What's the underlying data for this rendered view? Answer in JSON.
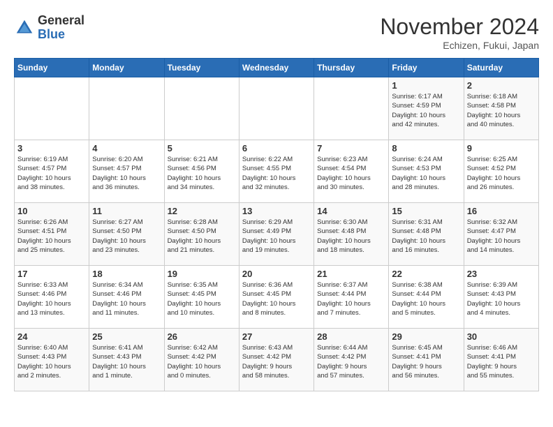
{
  "logo": {
    "general": "General",
    "blue": "Blue"
  },
  "title": "November 2024",
  "subtitle": "Echizen, Fukui, Japan",
  "days_header": [
    "Sunday",
    "Monday",
    "Tuesday",
    "Wednesday",
    "Thursday",
    "Friday",
    "Saturday"
  ],
  "weeks": [
    [
      {
        "day": "",
        "info": ""
      },
      {
        "day": "",
        "info": ""
      },
      {
        "day": "",
        "info": ""
      },
      {
        "day": "",
        "info": ""
      },
      {
        "day": "",
        "info": ""
      },
      {
        "day": "1",
        "info": "Sunrise: 6:17 AM\nSunset: 4:59 PM\nDaylight: 10 hours\nand 42 minutes."
      },
      {
        "day": "2",
        "info": "Sunrise: 6:18 AM\nSunset: 4:58 PM\nDaylight: 10 hours\nand 40 minutes."
      }
    ],
    [
      {
        "day": "3",
        "info": "Sunrise: 6:19 AM\nSunset: 4:57 PM\nDaylight: 10 hours\nand 38 minutes."
      },
      {
        "day": "4",
        "info": "Sunrise: 6:20 AM\nSunset: 4:57 PM\nDaylight: 10 hours\nand 36 minutes."
      },
      {
        "day": "5",
        "info": "Sunrise: 6:21 AM\nSunset: 4:56 PM\nDaylight: 10 hours\nand 34 minutes."
      },
      {
        "day": "6",
        "info": "Sunrise: 6:22 AM\nSunset: 4:55 PM\nDaylight: 10 hours\nand 32 minutes."
      },
      {
        "day": "7",
        "info": "Sunrise: 6:23 AM\nSunset: 4:54 PM\nDaylight: 10 hours\nand 30 minutes."
      },
      {
        "day": "8",
        "info": "Sunrise: 6:24 AM\nSunset: 4:53 PM\nDaylight: 10 hours\nand 28 minutes."
      },
      {
        "day": "9",
        "info": "Sunrise: 6:25 AM\nSunset: 4:52 PM\nDaylight: 10 hours\nand 26 minutes."
      }
    ],
    [
      {
        "day": "10",
        "info": "Sunrise: 6:26 AM\nSunset: 4:51 PM\nDaylight: 10 hours\nand 25 minutes."
      },
      {
        "day": "11",
        "info": "Sunrise: 6:27 AM\nSunset: 4:50 PM\nDaylight: 10 hours\nand 23 minutes."
      },
      {
        "day": "12",
        "info": "Sunrise: 6:28 AM\nSunset: 4:50 PM\nDaylight: 10 hours\nand 21 minutes."
      },
      {
        "day": "13",
        "info": "Sunrise: 6:29 AM\nSunset: 4:49 PM\nDaylight: 10 hours\nand 19 minutes."
      },
      {
        "day": "14",
        "info": "Sunrise: 6:30 AM\nSunset: 4:48 PM\nDaylight: 10 hours\nand 18 minutes."
      },
      {
        "day": "15",
        "info": "Sunrise: 6:31 AM\nSunset: 4:48 PM\nDaylight: 10 hours\nand 16 minutes."
      },
      {
        "day": "16",
        "info": "Sunrise: 6:32 AM\nSunset: 4:47 PM\nDaylight: 10 hours\nand 14 minutes."
      }
    ],
    [
      {
        "day": "17",
        "info": "Sunrise: 6:33 AM\nSunset: 4:46 PM\nDaylight: 10 hours\nand 13 minutes."
      },
      {
        "day": "18",
        "info": "Sunrise: 6:34 AM\nSunset: 4:46 PM\nDaylight: 10 hours\nand 11 minutes."
      },
      {
        "day": "19",
        "info": "Sunrise: 6:35 AM\nSunset: 4:45 PM\nDaylight: 10 hours\nand 10 minutes."
      },
      {
        "day": "20",
        "info": "Sunrise: 6:36 AM\nSunset: 4:45 PM\nDaylight: 10 hours\nand 8 minutes."
      },
      {
        "day": "21",
        "info": "Sunrise: 6:37 AM\nSunset: 4:44 PM\nDaylight: 10 hours\nand 7 minutes."
      },
      {
        "day": "22",
        "info": "Sunrise: 6:38 AM\nSunset: 4:44 PM\nDaylight: 10 hours\nand 5 minutes."
      },
      {
        "day": "23",
        "info": "Sunrise: 6:39 AM\nSunset: 4:43 PM\nDaylight: 10 hours\nand 4 minutes."
      }
    ],
    [
      {
        "day": "24",
        "info": "Sunrise: 6:40 AM\nSunset: 4:43 PM\nDaylight: 10 hours\nand 2 minutes."
      },
      {
        "day": "25",
        "info": "Sunrise: 6:41 AM\nSunset: 4:43 PM\nDaylight: 10 hours\nand 1 minute."
      },
      {
        "day": "26",
        "info": "Sunrise: 6:42 AM\nSunset: 4:42 PM\nDaylight: 10 hours\nand 0 minutes."
      },
      {
        "day": "27",
        "info": "Sunrise: 6:43 AM\nSunset: 4:42 PM\nDaylight: 9 hours\nand 58 minutes."
      },
      {
        "day": "28",
        "info": "Sunrise: 6:44 AM\nSunset: 4:42 PM\nDaylight: 9 hours\nand 57 minutes."
      },
      {
        "day": "29",
        "info": "Sunrise: 6:45 AM\nSunset: 4:41 PM\nDaylight: 9 hours\nand 56 minutes."
      },
      {
        "day": "30",
        "info": "Sunrise: 6:46 AM\nSunset: 4:41 PM\nDaylight: 9 hours\nand 55 minutes."
      }
    ]
  ]
}
